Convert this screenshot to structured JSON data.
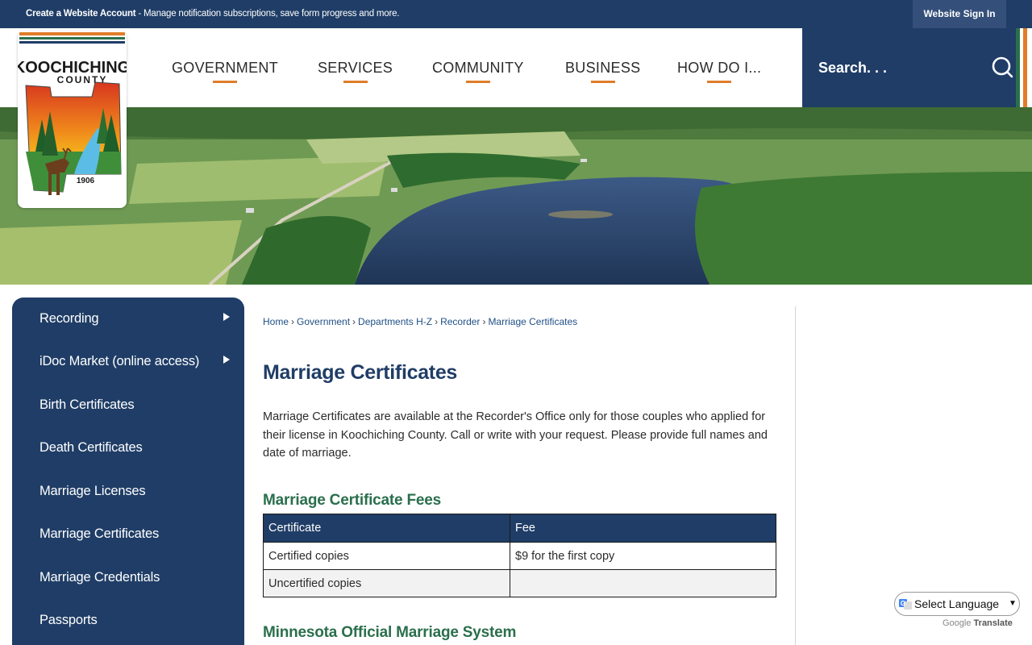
{
  "topbar": {
    "account_link": "Create a Website Account",
    "account_desc": " - Manage notification subscriptions, save form progress and more.",
    "signin_label": "Website Sign In"
  },
  "logo": {
    "name_line1": "KOOCHICHING",
    "name_line2": "COUNTY",
    "year": "1906"
  },
  "nav": {
    "items": [
      "GOVERNMENT",
      "SERVICES",
      "COMMUNITY",
      "BUSINESS",
      "HOW DO I..."
    ]
  },
  "search": {
    "placeholder": "Search. . ."
  },
  "sidebar": {
    "items": [
      {
        "label": "Recording",
        "has_submenu": true
      },
      {
        "label": "iDoc Market (online access)",
        "has_submenu": true
      },
      {
        "label": "Birth Certificates",
        "has_submenu": false
      },
      {
        "label": "Death Certificates",
        "has_submenu": false
      },
      {
        "label": "Marriage Licenses",
        "has_submenu": false
      },
      {
        "label": "Marriage Certificates",
        "has_submenu": false
      },
      {
        "label": "Marriage Credentials",
        "has_submenu": false
      },
      {
        "label": "Passports",
        "has_submenu": false
      }
    ]
  },
  "breadcrumb": [
    "Home",
    "Government",
    "Departments H-Z",
    "Recorder",
    "Marriage Certificates"
  ],
  "page": {
    "title": "Marriage Certificates",
    "intro": "Marriage Certificates are available at the Recorder's Office only for those couples who applied for their license in Koochiching County. Call or write with your request. Please provide full names and date of marriage.",
    "fees_heading": "Marriage Certificate Fees",
    "fees_table": {
      "headers": [
        "Certificate",
        "Fee"
      ],
      "rows": [
        [
          "Certified copies",
          "$9 for the first copy"
        ],
        [
          "Uncertified copies",
          ""
        ]
      ]
    },
    "system_heading": "Minnesota Official Marriage System"
  },
  "translate": {
    "select_label": "Select Language",
    "powered_by": "Google",
    "powered_suffix": "Translate"
  },
  "colors": {
    "navy": "#1f3d66",
    "accent_orange": "#e07c28",
    "heading_green": "#2a6f4c",
    "link_blue": "#1f4f86"
  },
  "icons": {
    "search": "search-icon",
    "submenu": "caret-right-icon",
    "google": "google-g-icon"
  }
}
